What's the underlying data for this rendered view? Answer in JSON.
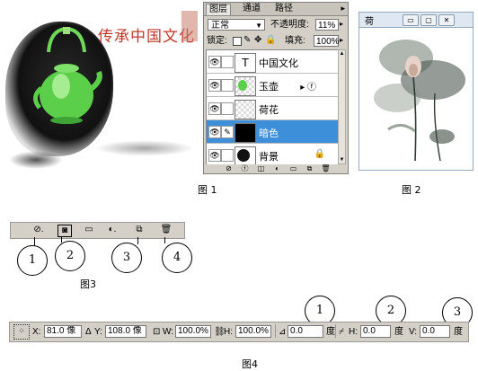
{
  "artwork": {
    "title": "传承中国文化"
  },
  "layers_panel": {
    "tabs": [
      "图层",
      "通道",
      "路径"
    ],
    "blend_mode": "正常",
    "opacity_label": "不透明度:",
    "opacity_value": "11%",
    "lock_label": "锁定:",
    "fill_label": "填充:",
    "fill_value": "100%",
    "layers": [
      {
        "name": "中国文化",
        "thumb": "type-icon",
        "active": false
      },
      {
        "name": "玉壶",
        "thumb": "checker",
        "active": false,
        "fx": "fx-icon"
      },
      {
        "name": "荷花",
        "thumb": "checker",
        "active": false
      },
      {
        "name": "暗色",
        "thumb": "black",
        "active": true
      },
      {
        "name": "背景",
        "thumb": "image",
        "active": false,
        "locked": true
      }
    ]
  },
  "lotus_window": {
    "title": "荷"
  },
  "captions": {
    "fig1": "图 1",
    "fig2": "图 2",
    "fig3": "图3",
    "fig4": "图4"
  },
  "figure3": {
    "callouts": [
      "1",
      "2",
      "3",
      "4"
    ]
  },
  "figure4": {
    "x_label": "X:",
    "x_value": "81.0 像",
    "y_label": "Y:",
    "y_value": "108.0 像",
    "w_label": "W:",
    "w_value": "100.0%",
    "h_label": "H:",
    "h_value": "100.0%",
    "angle_value": "0.0",
    "angle_unit": "度",
    "hskew_label": "H:",
    "hskew_value": "0.0",
    "hskew_unit": "度",
    "vskew_label": "V:",
    "vskew_value": "0.0",
    "vskew_unit": "度",
    "callouts": [
      "1",
      "2",
      "3"
    ]
  },
  "colors": {
    "title_red": "#c0392b",
    "active_layer": "#3c8fd8",
    "panel_gray": "#d4d0c8"
  }
}
